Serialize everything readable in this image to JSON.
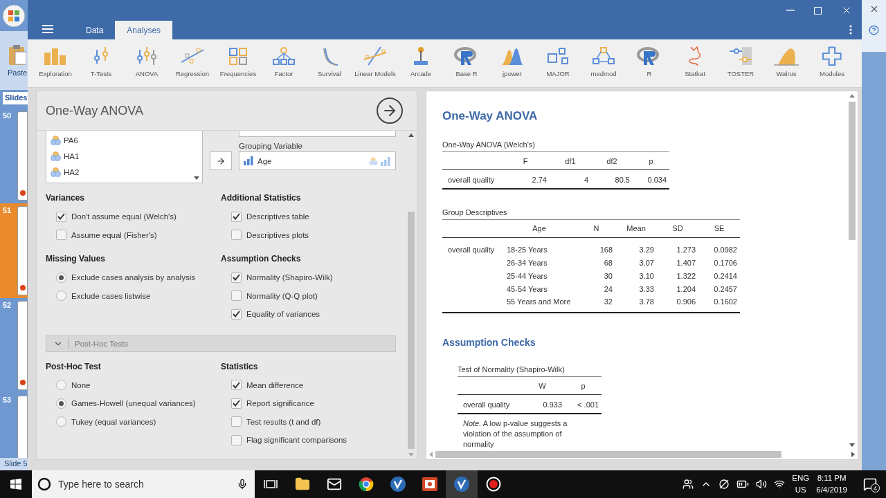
{
  "background_app": {
    "paste_label": "Paste",
    "slides_tab": "Slides",
    "slides": [
      {
        "number": "50",
        "selected": false
      },
      {
        "number": "51",
        "selected": true
      },
      {
        "number": "52",
        "selected": false
      },
      {
        "number": "53",
        "selected": false
      }
    ],
    "status": "Slide 5"
  },
  "window": {
    "tabs": [
      {
        "label": "Data",
        "selected": false
      },
      {
        "label": "Analyses",
        "selected": true
      }
    ]
  },
  "toolbar": [
    {
      "label": "Exploration",
      "kind": "bars"
    },
    {
      "label": "T-Tests",
      "kind": "ttest"
    },
    {
      "label": "ANOVA",
      "kind": "anova"
    },
    {
      "label": "Regression",
      "kind": "regression"
    },
    {
      "label": "Frequencies",
      "kind": "frequencies"
    },
    {
      "label": "Factor",
      "kind": "factor"
    },
    {
      "label": "Survival",
      "kind": "survival"
    },
    {
      "label": "Linear Models",
      "kind": "linear"
    },
    {
      "label": "Arcade",
      "kind": "arcade"
    },
    {
      "label": "Base R",
      "kind": "rlogo"
    },
    {
      "label": "jpower",
      "kind": "jpower"
    },
    {
      "label": "MAJOR",
      "kind": "major"
    },
    {
      "label": "medmod",
      "kind": "medmod"
    },
    {
      "label": "R",
      "kind": "rlogo"
    },
    {
      "label": "Statkat",
      "kind": "statkat"
    },
    {
      "label": "TOSTER",
      "kind": "toster"
    },
    {
      "label": "Walrus",
      "kind": "walrus"
    },
    {
      "label": "Modules",
      "kind": "modules"
    }
  ],
  "options_panel": {
    "title": "One-Way ANOVA",
    "variables": [
      "PA6",
      "HA1",
      "HA2"
    ],
    "grouping_label": "Grouping Variable",
    "grouping_value": "Age",
    "sections": [
      {
        "title": "Variances",
        "options": [
          {
            "kind": "checkbox",
            "label": "Don't assume equal (Welch's)",
            "checked": true
          },
          {
            "kind": "checkbox",
            "label": "Assume equal (Fisher's)",
            "checked": false
          }
        ]
      },
      {
        "title": "Additional Statistics",
        "options": [
          {
            "kind": "checkbox",
            "label": "Descriptives table",
            "checked": true
          },
          {
            "kind": "checkbox",
            "label": "Descriptives plots",
            "checked": false
          }
        ]
      },
      {
        "title": "Missing Values",
        "options": [
          {
            "kind": "radio",
            "label": "Exclude cases analysis by analysis",
            "selected": true
          },
          {
            "kind": "radio",
            "label": "Exclude cases listwise",
            "selected": false
          }
        ]
      },
      {
        "title": "Assumption Checks",
        "options": [
          {
            "kind": "checkbox",
            "label": "Normality (Shapiro-Wilk)",
            "checked": true
          },
          {
            "kind": "checkbox",
            "label": "Normality (Q-Q plot)",
            "checked": false
          },
          {
            "kind": "checkbox",
            "label": "Equality of variances",
            "checked": true
          }
        ]
      }
    ],
    "post_hoc_bar": "Post-Hoc Tests",
    "post_hoc_sections": [
      {
        "title": "Post-Hoc Test",
        "options": [
          {
            "kind": "radio",
            "label": "None",
            "selected": false
          },
          {
            "kind": "radio",
            "label": "Games-Howell (unequal variances)",
            "selected": true
          },
          {
            "kind": "radio",
            "label": "Tukey (equal variances)",
            "selected": false
          }
        ]
      },
      {
        "title": "Statistics",
        "options": [
          {
            "kind": "checkbox",
            "label": "Mean difference",
            "checked": true
          },
          {
            "kind": "checkbox",
            "label": "Report significance",
            "checked": true
          },
          {
            "kind": "checkbox",
            "label": "Test results (t and df)",
            "checked": false
          },
          {
            "kind": "checkbox",
            "label": "Flag significant comparisons",
            "checked": false
          }
        ]
      }
    ]
  },
  "results": {
    "title": "One-Way ANOVA",
    "welch_table": {
      "title": "One-Way ANOVA (Welch's)",
      "columns": [
        "F",
        "df1",
        "df2",
        "p"
      ],
      "rows": [
        {
          "label": "overall quality",
          "cells": [
            "2.74",
            "4",
            "80.5",
            "0.034"
          ]
        }
      ]
    },
    "descriptives_table": {
      "title": "Group Descriptives",
      "columns": [
        "Age",
        "N",
        "Mean",
        "SD",
        "SE"
      ],
      "rows": [
        {
          "label": "overall quality",
          "cells": [
            "18-25 Years",
            "168",
            "3.29",
            "1.273",
            "0.0982"
          ]
        },
        {
          "cells": [
            "26-34 Years",
            "68",
            "3.07",
            "1.407",
            "0.1706"
          ]
        },
        {
          "cells": [
            "25-44 Years",
            "30",
            "3.10",
            "1.322",
            "0.2414"
          ]
        },
        {
          "cells": [
            "45-54 Years",
            "24",
            "3.33",
            "1.204",
            "0.2457"
          ]
        },
        {
          "cells": [
            "55 Years and More",
            "32",
            "3.78",
            "0.906",
            "0.1602"
          ]
        }
      ]
    },
    "assumption_heading": "Assumption Checks",
    "normality_table": {
      "title": "Test of Normality (Shapiro-Wilk)",
      "columns": [
        "W",
        "p"
      ],
      "rows": [
        {
          "label": "overall quality",
          "cells": [
            "0.933",
            "< .001"
          ]
        }
      ],
      "note": "*Note.* A low p-value suggests a violation of the assumption of normality"
    }
  },
  "taskbar": {
    "search_placeholder": "Type here to search",
    "language": "ENG",
    "region": "US",
    "time": "8:11 PM",
    "date": "6/4/2019",
    "notifications": "4"
  }
}
